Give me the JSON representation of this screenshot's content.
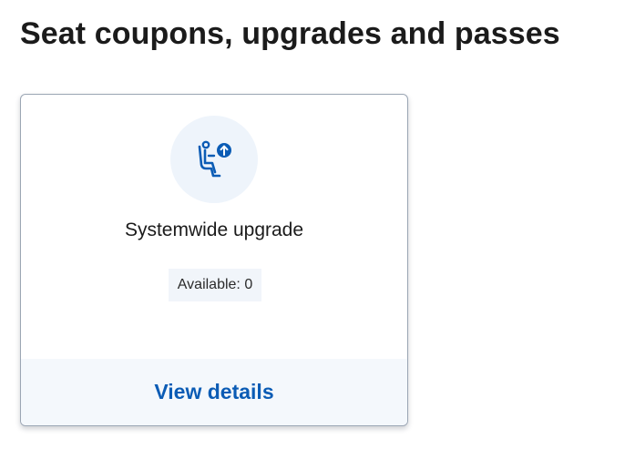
{
  "page": {
    "title": "Seat coupons, upgrades and passes"
  },
  "card": {
    "icon": "seat-upgrade-icon",
    "title": "Systemwide upgrade",
    "availability": "Available: 0",
    "action_label": "View details"
  },
  "colors": {
    "accent": "#0b5cb5",
    "icon_circle_bg": "#eef4fb",
    "footer_bg": "#f4f8fc",
    "badge_bg": "#f1f5fa"
  }
}
